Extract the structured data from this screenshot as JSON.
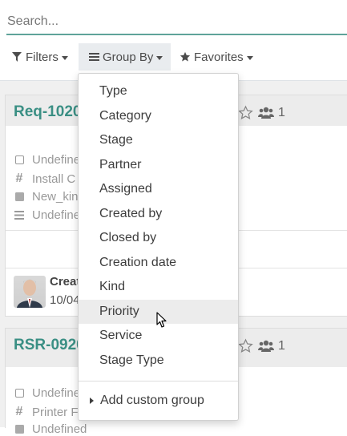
{
  "search": {
    "placeholder": "Search..."
  },
  "toolbar": {
    "filters": "Filters",
    "group_by": "Group By",
    "favorites": "Favorites"
  },
  "cards": [
    {
      "title": "Req-1020",
      "followers": "1",
      "rows": [
        "Undefined",
        "Install C",
        "New_kin",
        "Undefine"
      ],
      "creator_label": "Creat",
      "creator_date": "10/04"
    },
    {
      "title": "RSR-0920",
      "followers": "1",
      "rows": [
        "Undefine",
        "Printer F",
        "Undefined"
      ]
    }
  ],
  "group_by_menu": {
    "items": [
      "Type",
      "Category",
      "Stage",
      "Partner",
      "Assigned",
      "Created by",
      "Closed by",
      "Creation date",
      "Kind",
      "Priority",
      "Service",
      "Stage Type"
    ],
    "highlighted": "Priority",
    "custom": "Add custom group"
  },
  "colors": {
    "accent": "#3a8f84",
    "search_underline": "#5fa39a"
  }
}
